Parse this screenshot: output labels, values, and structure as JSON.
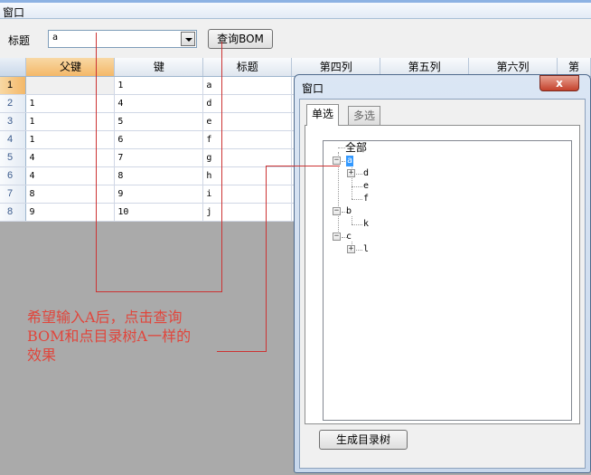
{
  "window": {
    "title": "窗口"
  },
  "form": {
    "title_label": "标题",
    "title_value": "a",
    "query_button": "查询BOM"
  },
  "grid": {
    "columns": [
      "父键",
      "键",
      "标题",
      "第四列",
      "第五列",
      "第六列",
      "第"
    ],
    "rows": [
      {
        "num": "1",
        "parent": "",
        "key": "1",
        "title": "a"
      },
      {
        "num": "2",
        "parent": "1",
        "key": "4",
        "title": "d"
      },
      {
        "num": "3",
        "parent": "1",
        "key": "5",
        "title": "e"
      },
      {
        "num": "4",
        "parent": "1",
        "key": "6",
        "title": "f"
      },
      {
        "num": "5",
        "parent": "4",
        "key": "7",
        "title": "g"
      },
      {
        "num": "6",
        "parent": "4",
        "key": "8",
        "title": "h"
      },
      {
        "num": "7",
        "parent": "8",
        "key": "9",
        "title": "i"
      },
      {
        "num": "8",
        "parent": "9",
        "key": "10",
        "title": "j"
      }
    ]
  },
  "annotation": {
    "lines": [
      "希望输入A后，点击查询",
      "BOM和点目录树A一样的",
      "效果"
    ]
  },
  "dialog": {
    "title": "窗口",
    "close_glyph": "x",
    "tabs": [
      "单选",
      "多选"
    ],
    "tree": {
      "root": "全部",
      "nodes": [
        "a",
        "d",
        "e",
        "f",
        "b",
        "k",
        "c",
        "l"
      ]
    },
    "generate_button": "生成目录树"
  },
  "colors": {
    "annotation": "#e0463c",
    "selection": "#3399ff",
    "active_header": "#f4b868"
  }
}
